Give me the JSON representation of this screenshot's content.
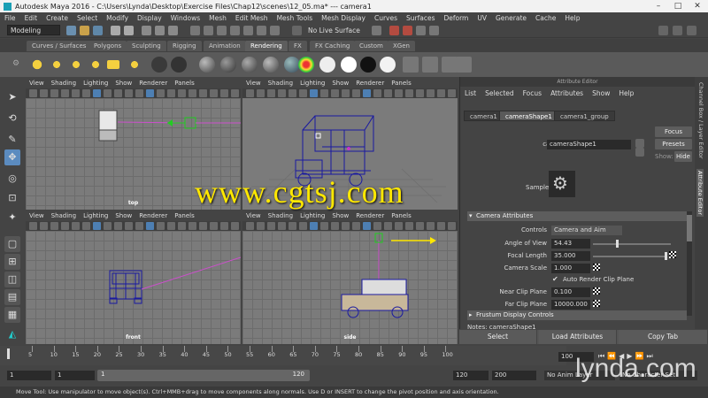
{
  "title": "Autodesk Maya 2016 - C:\\Users\\Lynda\\Desktop\\Exercise Files\\Chap12\\scenes\\12_05.ma* --- camera1",
  "menubar": [
    "File",
    "Edit",
    "Create",
    "Select",
    "Modify",
    "Display",
    "Windows",
    "Mesh",
    "Edit Mesh",
    "Mesh Tools",
    "Mesh Display",
    "Curves",
    "Surfaces",
    "Deform",
    "UV",
    "Generate",
    "Cache",
    "Help"
  ],
  "statusline": {
    "mode": "Modeling",
    "live_surface": "No Live Surface"
  },
  "shelf_tabs": [
    "Curves / Surfaces",
    "Polygons",
    "Sculpting",
    "Rigging",
    "Animation",
    "Rendering",
    "FX",
    "FX Caching",
    "Custom",
    "XGen"
  ],
  "active_shelf_tab": "Rendering",
  "panel_menu": [
    "View",
    "Shading",
    "Lighting",
    "Show",
    "Renderer",
    "Panels"
  ],
  "viewports": {
    "top": "top",
    "persp": "persp",
    "front": "front",
    "side": "side"
  },
  "attribute_editor": {
    "header": "Attribute Editor",
    "menu": [
      "List",
      "Selected",
      "Focus",
      "Attributes",
      "Show",
      "Help"
    ],
    "tabs": [
      "camera1",
      "cameraShape1",
      "camera1_group"
    ],
    "active_tab": "cameraShape1",
    "node_type_label": "camera:",
    "node_name": "cameraShape1",
    "focus_label": "Focus",
    "presets_label": "Presets",
    "show_label": "Show:",
    "hide_label": "Hide",
    "sample_label": "Sample",
    "section_camera_attributes": "Camera Attributes",
    "controls_label": "Controls",
    "controls_value": "Camera and Aim",
    "angle_of_view_label": "Angle of View",
    "angle_of_view": "54.43",
    "focal_length_label": "Focal Length",
    "focal_length": "35.000",
    "camera_scale_label": "Camera Scale",
    "camera_scale": "1.000",
    "auto_render_clip_label": "Auto Render Clip Plane",
    "near_clip_label": "Near Clip Plane",
    "near_clip": "0.100",
    "far_clip_label": "Far Clip Plane",
    "far_clip": "10000.000",
    "section_frustum": "Frustum Display Controls",
    "notes_label": "Notes: cameraShape1"
  },
  "right_strip": {
    "channel_box": "Channel Box / Layer Editor",
    "attribute_editor": "Attribute Editor"
  },
  "bottom_buttons": [
    "Select",
    "Load Attributes",
    "Copy Tab"
  ],
  "timeline": {
    "ticks": [
      "5",
      "10",
      "15",
      "20",
      "25",
      "30",
      "35",
      "40",
      "45",
      "50",
      "55",
      "60",
      "65",
      "70",
      "75",
      "80",
      "85",
      "90",
      "95",
      "100"
    ],
    "current_frame": "100",
    "start_marker": "1"
  },
  "range": {
    "start": "1",
    "start2": "1",
    "slider_start": "1",
    "slider_end": "120",
    "end": "120",
    "end2": "200",
    "anim_layer": "No Anim Layer",
    "char_set": "No Character Set"
  },
  "help_line": "Move Tool: Use manipulator to move object(s). Ctrl+MMB+drag to move components along normals. Use D or INSERT to change the pivot position and axis orientation.",
  "watermark": "www.cgtsj.com",
  "lynda_watermark": "lynda.com"
}
